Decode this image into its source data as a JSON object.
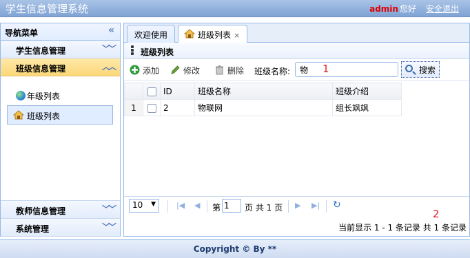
{
  "header": {
    "title": "学生信息管理系统",
    "user": "admin",
    "greeting": "您好",
    "logout_label": "安全退出"
  },
  "nav": {
    "title": "导航菜单",
    "collapse_icon": "double-chevron-left-icon",
    "sections": [
      {
        "label": "学生信息管理"
      },
      {
        "label": "班级信息管理",
        "items": [
          {
            "label": "年级列表",
            "icon": "globe-icon"
          },
          {
            "label": "班级列表",
            "icon": "home-icon"
          }
        ]
      },
      {
        "label": "教师信息管理"
      },
      {
        "label": "系统管理"
      }
    ]
  },
  "tabs": [
    {
      "label": "欢迎使用"
    },
    {
      "label": "班级列表",
      "close": "×"
    }
  ],
  "panel": {
    "title": "班级列表"
  },
  "toolbar": {
    "add_label": "添加",
    "edit_label": "修改",
    "delete_label": "删除",
    "search_label": "班级名称:",
    "search_value": "物",
    "search_button": "搜索"
  },
  "annotations": {
    "one": "1",
    "two": "2"
  },
  "grid": {
    "columns": [
      "ID",
      "班级名称",
      "班级介绍"
    ],
    "rows": [
      {
        "num": "1",
        "id": "2",
        "name": "物联网",
        "intro": "组长飒飒"
      }
    ]
  },
  "pager": {
    "page_size": "10",
    "page_prefix": "第",
    "page_value": "1",
    "page_suffix": "页 共 1 页",
    "info": "当前显示 1 - 1 条记录 共 1 条记录"
  },
  "footer": {
    "text": "Copyright © By **"
  },
  "colors": {
    "accent": "#95b8e7",
    "active_section": "#fbd778",
    "annotation": "#e02020",
    "user": "#e00000"
  }
}
